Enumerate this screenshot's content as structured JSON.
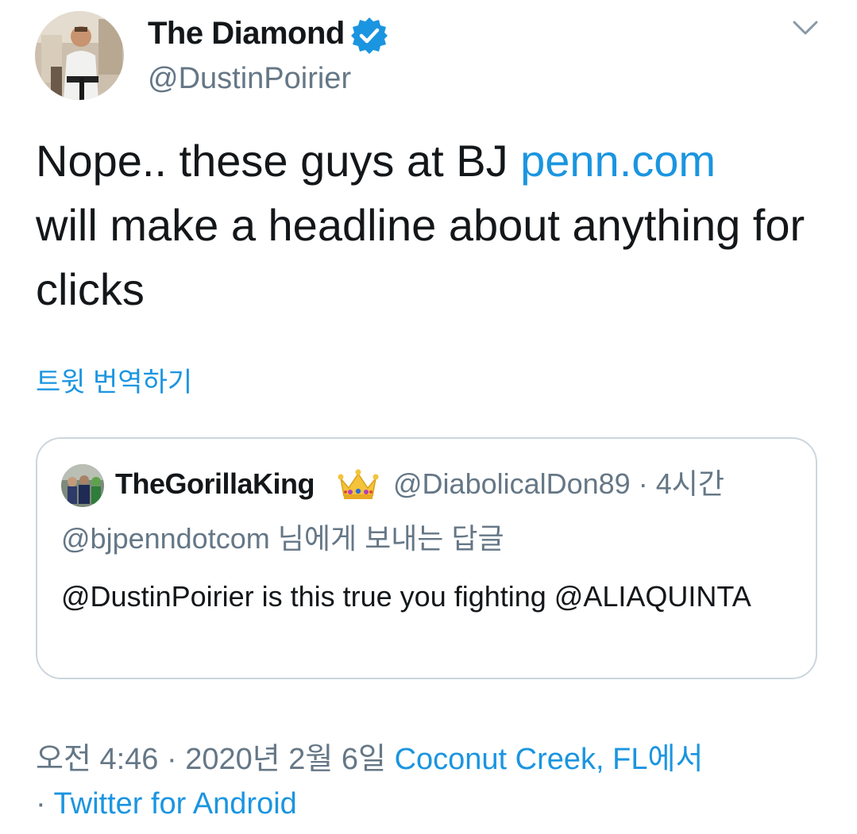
{
  "author": {
    "display_name": "The Diamond",
    "handle": "@DustinPoirier",
    "avatar_icon": "profile-photo",
    "verified_icon": "verified-badge-icon"
  },
  "tweet": {
    "text_before_link": "Nope.. these guys at BJ ",
    "link_text": "penn.com",
    "text_after_link": " will make a headline about anything for clicks",
    "translate_label": "트윗 번역하기"
  },
  "quoted_tweet": {
    "display_name": "TheGorillaKing",
    "name_emoji_icon": "crown-icon",
    "handle": "@DiabolicalDon89",
    "separator": " · ",
    "time": "4시간",
    "reply_context": "@bjpenndotcom 님에게 보내는 답글",
    "text": "@DustinPoirier is this true you fighting @ALIAQUINTA"
  },
  "footer": {
    "time_prefix": "오전 4:46 · 2020년 2월 6일 ",
    "location": "Coconut Creek, FL에서",
    "source_separator": " · ",
    "source": "Twitter for Android"
  },
  "colors": {
    "accent": "#1b95e0",
    "secondary_text": "#657786",
    "primary_text": "#14171a",
    "border": "#ccd6dd"
  }
}
